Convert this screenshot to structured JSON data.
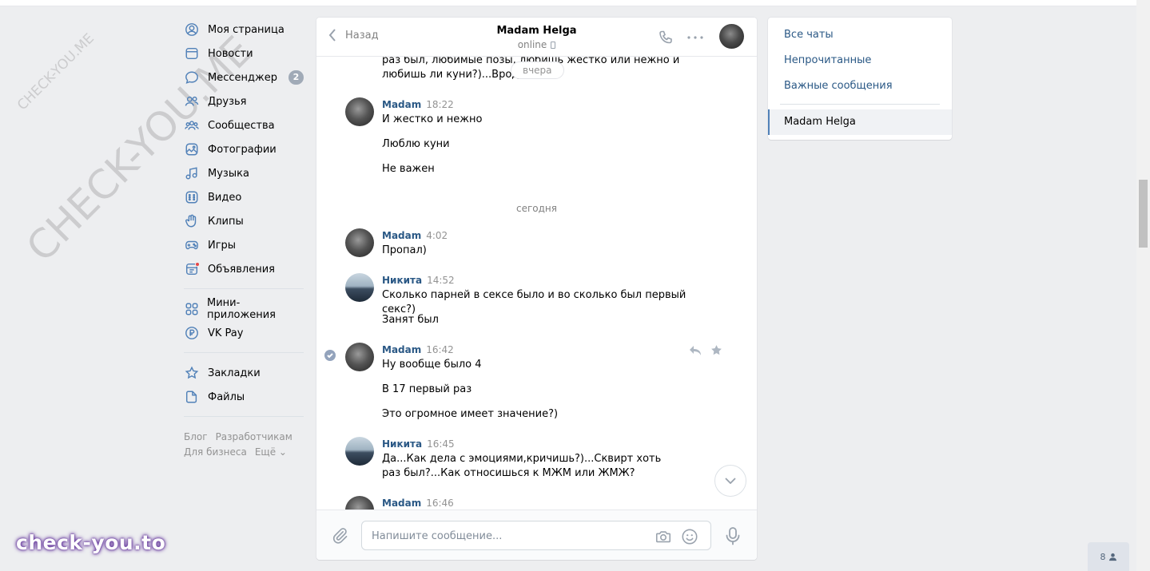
{
  "watermarks": {
    "small": "CHECK-YOU.ME",
    "large": "CHECK-YOU.ME",
    "badge": "check-you.to"
  },
  "leftnav": {
    "items": [
      {
        "label": "Моя страница",
        "icon": "user-icon"
      },
      {
        "label": "Новости",
        "icon": "news-icon"
      },
      {
        "label": "Мессенджер",
        "icon": "messenger-icon",
        "count": "2"
      },
      {
        "label": "Друзья",
        "icon": "friends-icon"
      },
      {
        "label": "Сообщества",
        "icon": "communities-icon"
      },
      {
        "label": "Фотографии",
        "icon": "photos-icon"
      },
      {
        "label": "Музыка",
        "icon": "music-icon"
      },
      {
        "label": "Видео",
        "icon": "video-icon"
      },
      {
        "label": "Клипы",
        "icon": "clips-icon"
      },
      {
        "label": "Игры",
        "icon": "games-icon"
      },
      {
        "label": "Объявления",
        "icon": "ads-icon"
      }
    ],
    "items2": [
      {
        "label": "Мини-приложения",
        "icon": "apps-icon"
      },
      {
        "label": "VK Pay",
        "icon": "vkpay-icon"
      }
    ],
    "items3": [
      {
        "label": "Закладки",
        "icon": "bookmark-icon"
      },
      {
        "label": "Файлы",
        "icon": "files-icon"
      }
    ],
    "footer": {
      "blog": "Блог",
      "dev": "Разработчикам",
      "business": "Для бизнеса",
      "more": "Ещё ⌄"
    }
  },
  "chat": {
    "back_label": "Назад",
    "title": "Madam Helga",
    "status": "online",
    "top_partial_text": "раз был, любимые позы, любишь жёстко или нежно и любишь ли куни?)...Вроде всё",
    "day_pill": "вчера",
    "day_today": "сегодня",
    "messages": [
      {
        "author": "Madam",
        "time": "18:22",
        "lines": [
          "И жестко и нежно",
          "Люблю куни",
          "Не важен"
        ]
      },
      {
        "author": "Madam",
        "time": "4:02",
        "lines": [
          "Пропал)"
        ]
      },
      {
        "author": "Никита",
        "time": "14:52",
        "lines": [
          "Сколько парней в сексе было и во сколько был первый секс?)",
          "Занят был"
        ]
      },
      {
        "author": "Madam",
        "time": "16:42",
        "lines": [
          "Ну вообще было 4",
          "В 17 первый раз",
          "Это огромное имеет значение?)"
        ]
      },
      {
        "author": "Никита",
        "time": "16:45",
        "lines": [
          "Да...Как дела с эмоциями,кричишь?)...Сквирт хоть раз был?...Как относишься к МЖМ или ЖМЖ?"
        ]
      },
      {
        "author": "Madam",
        "time": "16:46",
        "lines": []
      }
    ],
    "composer_placeholder": "Напишите сообщение..."
  },
  "rightpanel": {
    "all_chats": "Все чаты",
    "unread": "Непрочитанные",
    "important": "Важные сообщения",
    "active_chat": "Madam Helga"
  },
  "online_widget": {
    "count": "8"
  },
  "colors": {
    "accent": "#5181b8",
    "link": "#2a5885",
    "background": "#edeef0"
  }
}
